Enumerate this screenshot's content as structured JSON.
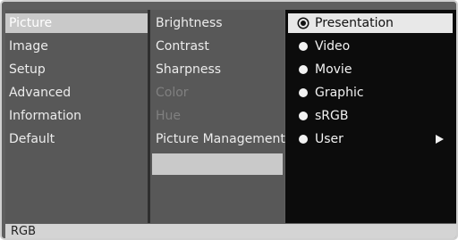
{
  "main_menu": {
    "items": [
      "Picture",
      "Image",
      "Setup",
      "Advanced",
      "Information",
      "Default"
    ]
  },
  "sub_menu": {
    "items": [
      "Brightness",
      "Contrast",
      "Sharpness",
      "Color",
      "Hue",
      "Picture Management"
    ]
  },
  "options": {
    "items": [
      "Presentation",
      "Video",
      "Movie",
      "Graphic",
      "sRGB",
      "User"
    ],
    "selected": "Presentation"
  },
  "status": {
    "source": "RGB"
  }
}
